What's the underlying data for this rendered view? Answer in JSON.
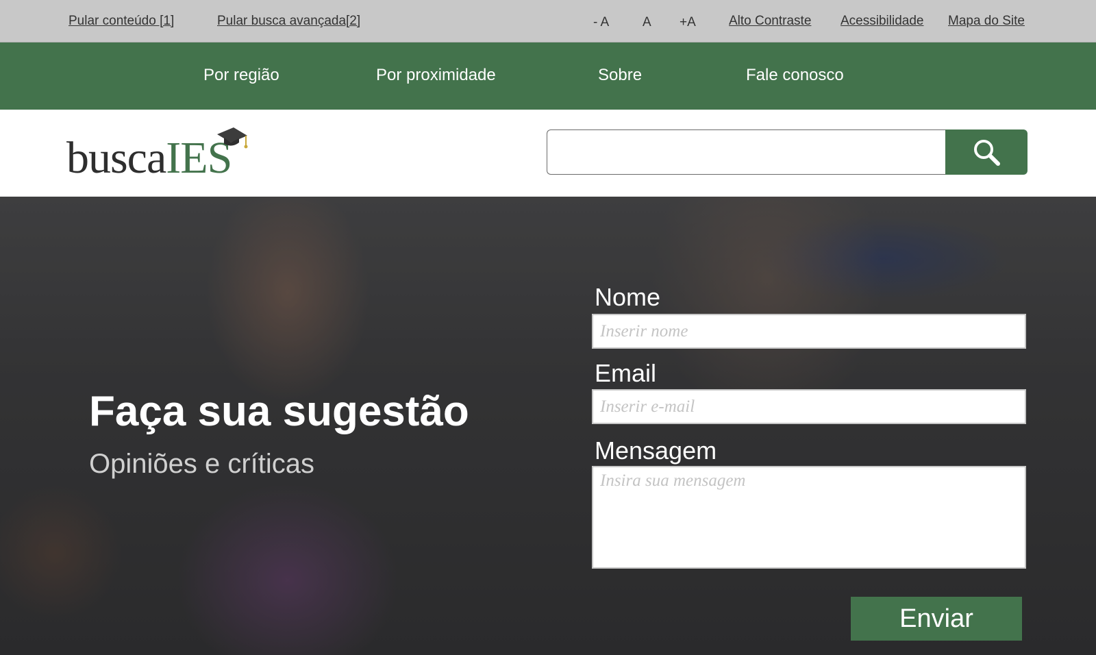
{
  "a11y_bar": {
    "skip_content": "Pular conteúdo [1]",
    "skip_search": "Pular busca avançada[2]",
    "font_decrease": "- A",
    "font_normal": "A",
    "font_increase": "+A",
    "high_contrast": "Alto Contraste",
    "accessibility": "Acessibilidade",
    "sitemap": "Mapa do Site"
  },
  "nav": {
    "items": [
      "Por região",
      "Por proximidade",
      "Sobre",
      "Fale conosco"
    ]
  },
  "logo": {
    "part1": "busca",
    "part2": "IES",
    "icon": "graduation-cap-icon"
  },
  "search": {
    "value": "",
    "icon": "search-icon"
  },
  "hero": {
    "title": "Faça sua sugestão",
    "subtitle": "Opiniões e críticas"
  },
  "form": {
    "name_label": "Nome",
    "name_placeholder": "Inserir nome",
    "email_label": "Email",
    "email_placeholder": "Inserir e-mail",
    "message_label": "Mensagem",
    "message_placeholder": "Insira sua mensagem",
    "submit_label": "Enviar"
  },
  "colors": {
    "accent_green": "#43734c",
    "top_bar_gray": "#c8c8c8"
  }
}
